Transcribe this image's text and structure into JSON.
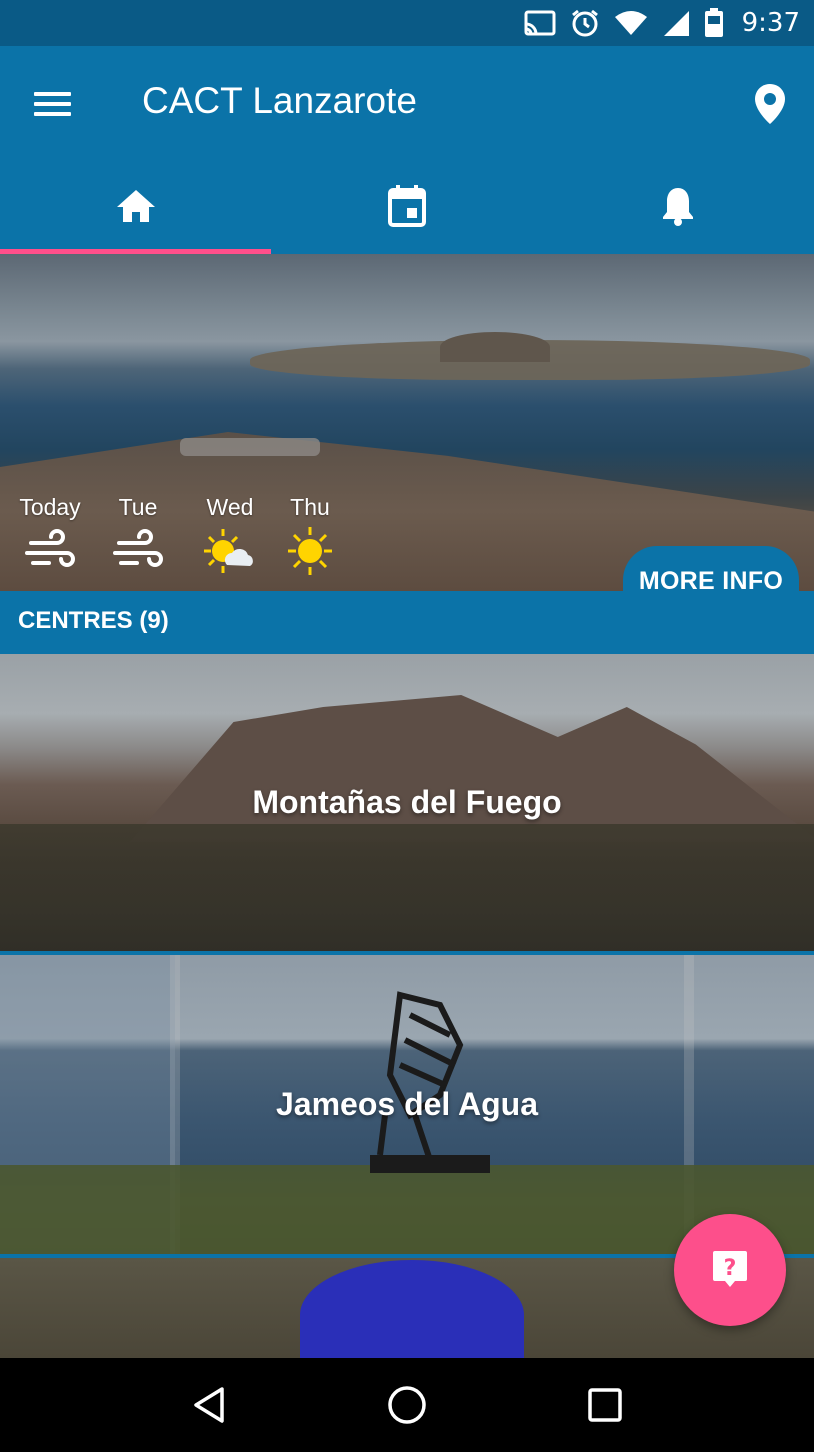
{
  "status_bar": {
    "time": "9:37",
    "icons": [
      "cast-icon",
      "alarm-icon",
      "wifi-icon",
      "signal-icon",
      "battery-icon"
    ]
  },
  "app_bar": {
    "title": "CACT Lanzarote",
    "menu_icon": "hamburger-menu-icon",
    "location_icon": "location-pin-icon"
  },
  "tabs": [
    {
      "icon": "home-icon",
      "selected": true
    },
    {
      "icon": "calendar-icon",
      "selected": false
    },
    {
      "icon": "bell-icon",
      "selected": false
    }
  ],
  "accent_colors": {
    "primary": "#0b73a8",
    "indicator": "#ff4f8b",
    "fab": "#fd4f8b"
  },
  "forecast": [
    {
      "day": "Today",
      "icon": "wind-icon"
    },
    {
      "day": "Tue",
      "icon": "wind-icon"
    },
    {
      "day": "Wed",
      "icon": "partly-cloudy-icon"
    },
    {
      "day": "Thu",
      "icon": "sun-icon"
    }
  ],
  "more_info_label": "MORE INFO",
  "centres": {
    "header": "CENTRES (9)",
    "items": [
      {
        "name": "Montañas del Fuego"
      },
      {
        "name": "Jameos del Agua"
      },
      {
        "name": ""
      }
    ]
  },
  "fab_icon": "help-icon",
  "nav_bar": [
    "back-icon",
    "home-circle-icon",
    "recents-icon"
  ]
}
